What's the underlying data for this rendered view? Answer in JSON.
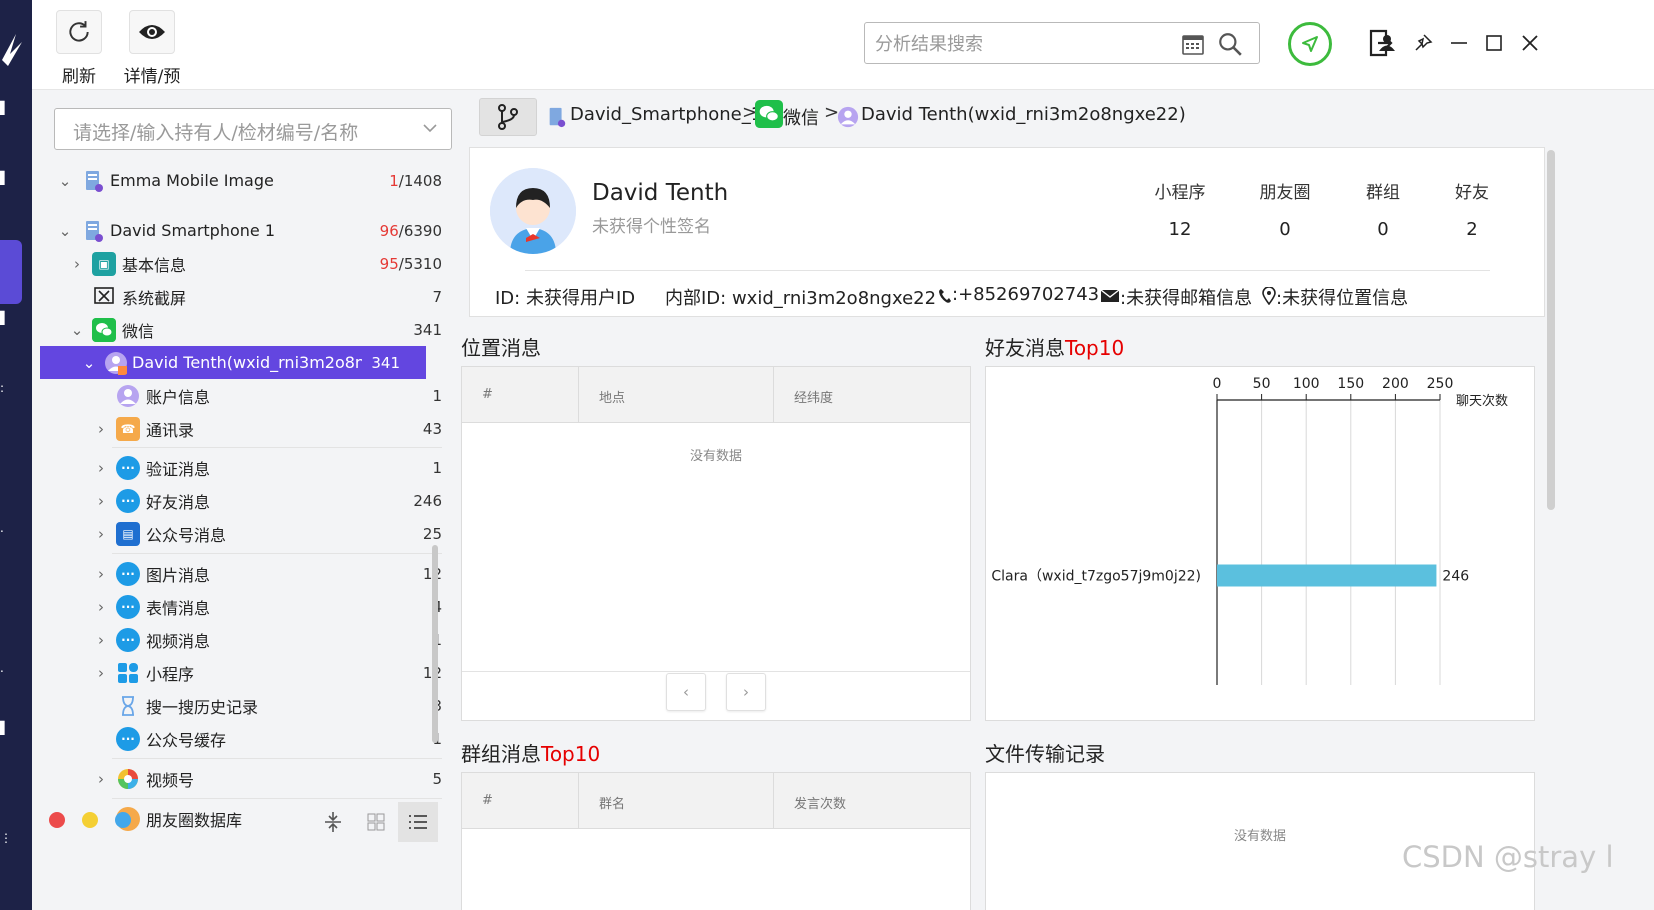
{
  "toolbar": {
    "refresh_label": "刷新",
    "detail_label": "详情/预览"
  },
  "search": {
    "placeholder": "分析结果搜索"
  },
  "case_select": {
    "placeholder": "请选择/输入持有人/检材编号/名称"
  },
  "tree": {
    "n1": {
      "label": "Emma Mobile Image",
      "count_hl": "1",
      "count_rest": "/1408"
    },
    "n2": {
      "label": "David Smartphone 1",
      "count_hl": "96",
      "count_rest": "/6390"
    },
    "n3": {
      "label": "基本信息",
      "count_hl": "95",
      "count_rest": "/5310"
    },
    "n4": {
      "label": "系统截屏",
      "count": "7"
    },
    "n5": {
      "label": "微信",
      "count": "341"
    },
    "n6": {
      "label": "David Tenth(wxid_rni3m2o8n...",
      "count": "341"
    },
    "n7": {
      "label": "账户信息",
      "count": "1"
    },
    "n8": {
      "label": "通讯录",
      "count": "43"
    },
    "n9": {
      "label": "验证消息",
      "count": "1"
    },
    "n10": {
      "label": "好友消息",
      "count": "246"
    },
    "n11": {
      "label": "公众号消息",
      "count": "25"
    },
    "n12": {
      "label": "图片消息",
      "count": "12"
    },
    "n13": {
      "label": "表情消息",
      "count": "4"
    },
    "n14": {
      "label": "视频消息",
      "count": "1"
    },
    "n15": {
      "label": "小程序",
      "count": "12"
    },
    "n16": {
      "label": "搜一搜历史记录",
      "count": "3"
    },
    "n17": {
      "label": "公众号缓存",
      "count": "1"
    },
    "n18": {
      "label": "视频号",
      "count": "5"
    },
    "n19": {
      "label": "朋友圈数据库",
      "count": ""
    }
  },
  "breadcrumb": {
    "b1": "David_Smartphone_1",
    "b2": "微信",
    "b3": "David Tenth(wxid_rni3m2o8ngxe22)",
    "sep": ">"
  },
  "profile": {
    "name": "David Tenth",
    "signature": "未获得个性签名",
    "stats": [
      {
        "label": "小程序",
        "value": "12"
      },
      {
        "label": "朋友圈",
        "value": "0"
      },
      {
        "label": "群组",
        "value": "0"
      },
      {
        "label": "好友",
        "value": "2"
      }
    ],
    "id": "ID: 未获得用户ID",
    "internal_id": "内部ID: wxid_rni3m2o8ngxe22",
    "phone": ":+85269702743",
    "email": ":未获得邮箱信息",
    "location": ":未获得位置信息"
  },
  "location_section": {
    "title": "位置消息",
    "columns": [
      "#",
      "地点",
      "经纬度"
    ],
    "empty": "没有数据"
  },
  "friend_section": {
    "title_a": "好友消息",
    "title_b": "Top10"
  },
  "group_section": {
    "title_a": "群组消息",
    "title_b": "Top10",
    "columns": [
      "#",
      "群名",
      "发言次数"
    ]
  },
  "file_section": {
    "title": "文件传输记录",
    "empty": "没有数据"
  },
  "chart_data": {
    "type": "bar",
    "orientation": "horizontal",
    "categories": [
      "Clara（wxid_t7zgo57j9m0j22)"
    ],
    "values": [
      246
    ],
    "ticks": [
      0,
      50,
      100,
      150,
      200,
      250
    ],
    "xlim": [
      0,
      250
    ],
    "xlabel": "聊天次数",
    "value_labels": [
      "246"
    ],
    "bar_color": "#5bc0de",
    "grid": true
  },
  "watermark": "CSDN @stray l",
  "colors": {
    "accent": "#6346e0",
    "highlight": "#e60000",
    "rail": "#1d2247"
  }
}
